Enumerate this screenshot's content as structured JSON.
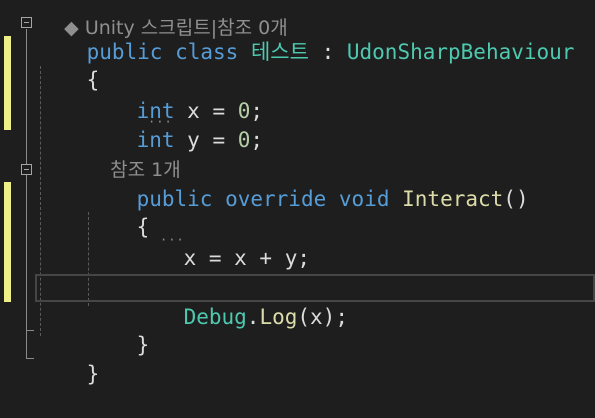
{
  "top_hint": "◆ Unity 스크립트|참조 0개",
  "lines": {
    "class_decl": {
      "kw_public": "public",
      "kw_class": "class",
      "name": "테스트",
      "colon": " : ",
      "base": "UdonSharpBehaviour"
    },
    "open_brace_1": "{",
    "field_x": {
      "type": "int",
      "rest": " x = ",
      "num": "0",
      "end": ";"
    },
    "field_y": {
      "type": "int",
      "rest": " y = ",
      "num": "0",
      "end": ";"
    },
    "ref_hint": "참조 1개",
    "method_decl": {
      "kw_public": "public",
      "kw_override": "override",
      "kw_void": "void",
      "name": "Interact",
      "parens": "()"
    },
    "open_brace_2": "{",
    "assign": "x = x + y;",
    "debug_line": {
      "cls": "Debug",
      "dot": ".",
      "method": "Log",
      "args": "(x);"
    },
    "close_brace_2": "}",
    "close_brace_1": "}"
  },
  "colors": {
    "background": "#1e1e1e",
    "keyword": "#569cd6",
    "type_name": "#4ec9b0",
    "method_name": "#dcdcaa",
    "number": "#b5cea8",
    "plain_text": "#dcdcdc",
    "change_marker": "#efef8a"
  }
}
